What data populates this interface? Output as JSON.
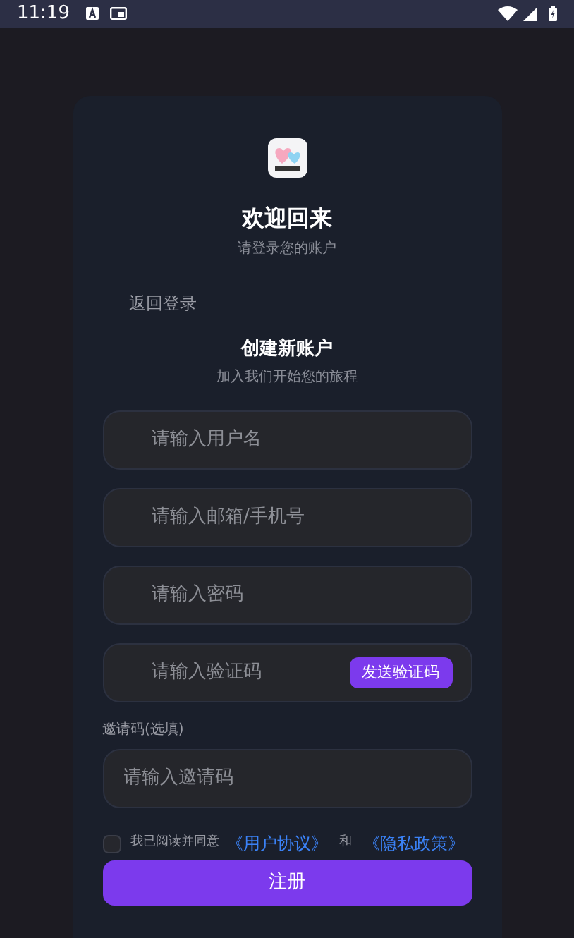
{
  "status_bar": {
    "time": "11:19"
  },
  "header": {
    "title": "欢迎回来",
    "subtitle": "请登录您的账户"
  },
  "back_link": "返回登录",
  "register": {
    "title": "创建新账户",
    "subtitle": "加入我们开始您的旅程"
  },
  "fields": [
    {
      "placeholder": "请输入用户名"
    },
    {
      "placeholder": "请输入邮箱/手机号"
    },
    {
      "placeholder": "请输入密码"
    },
    {
      "placeholder": "请输入验证码",
      "button": "发送验证码"
    }
  ],
  "invite": {
    "label": "邀请码(选填)",
    "placeholder": "请输入邀请码"
  },
  "agreement": {
    "checked": false,
    "text": "我已阅读并同意",
    "link_1": "《用户协议》",
    "and": "和",
    "link_2": "《隐私政策》"
  },
  "submit": "注册"
}
